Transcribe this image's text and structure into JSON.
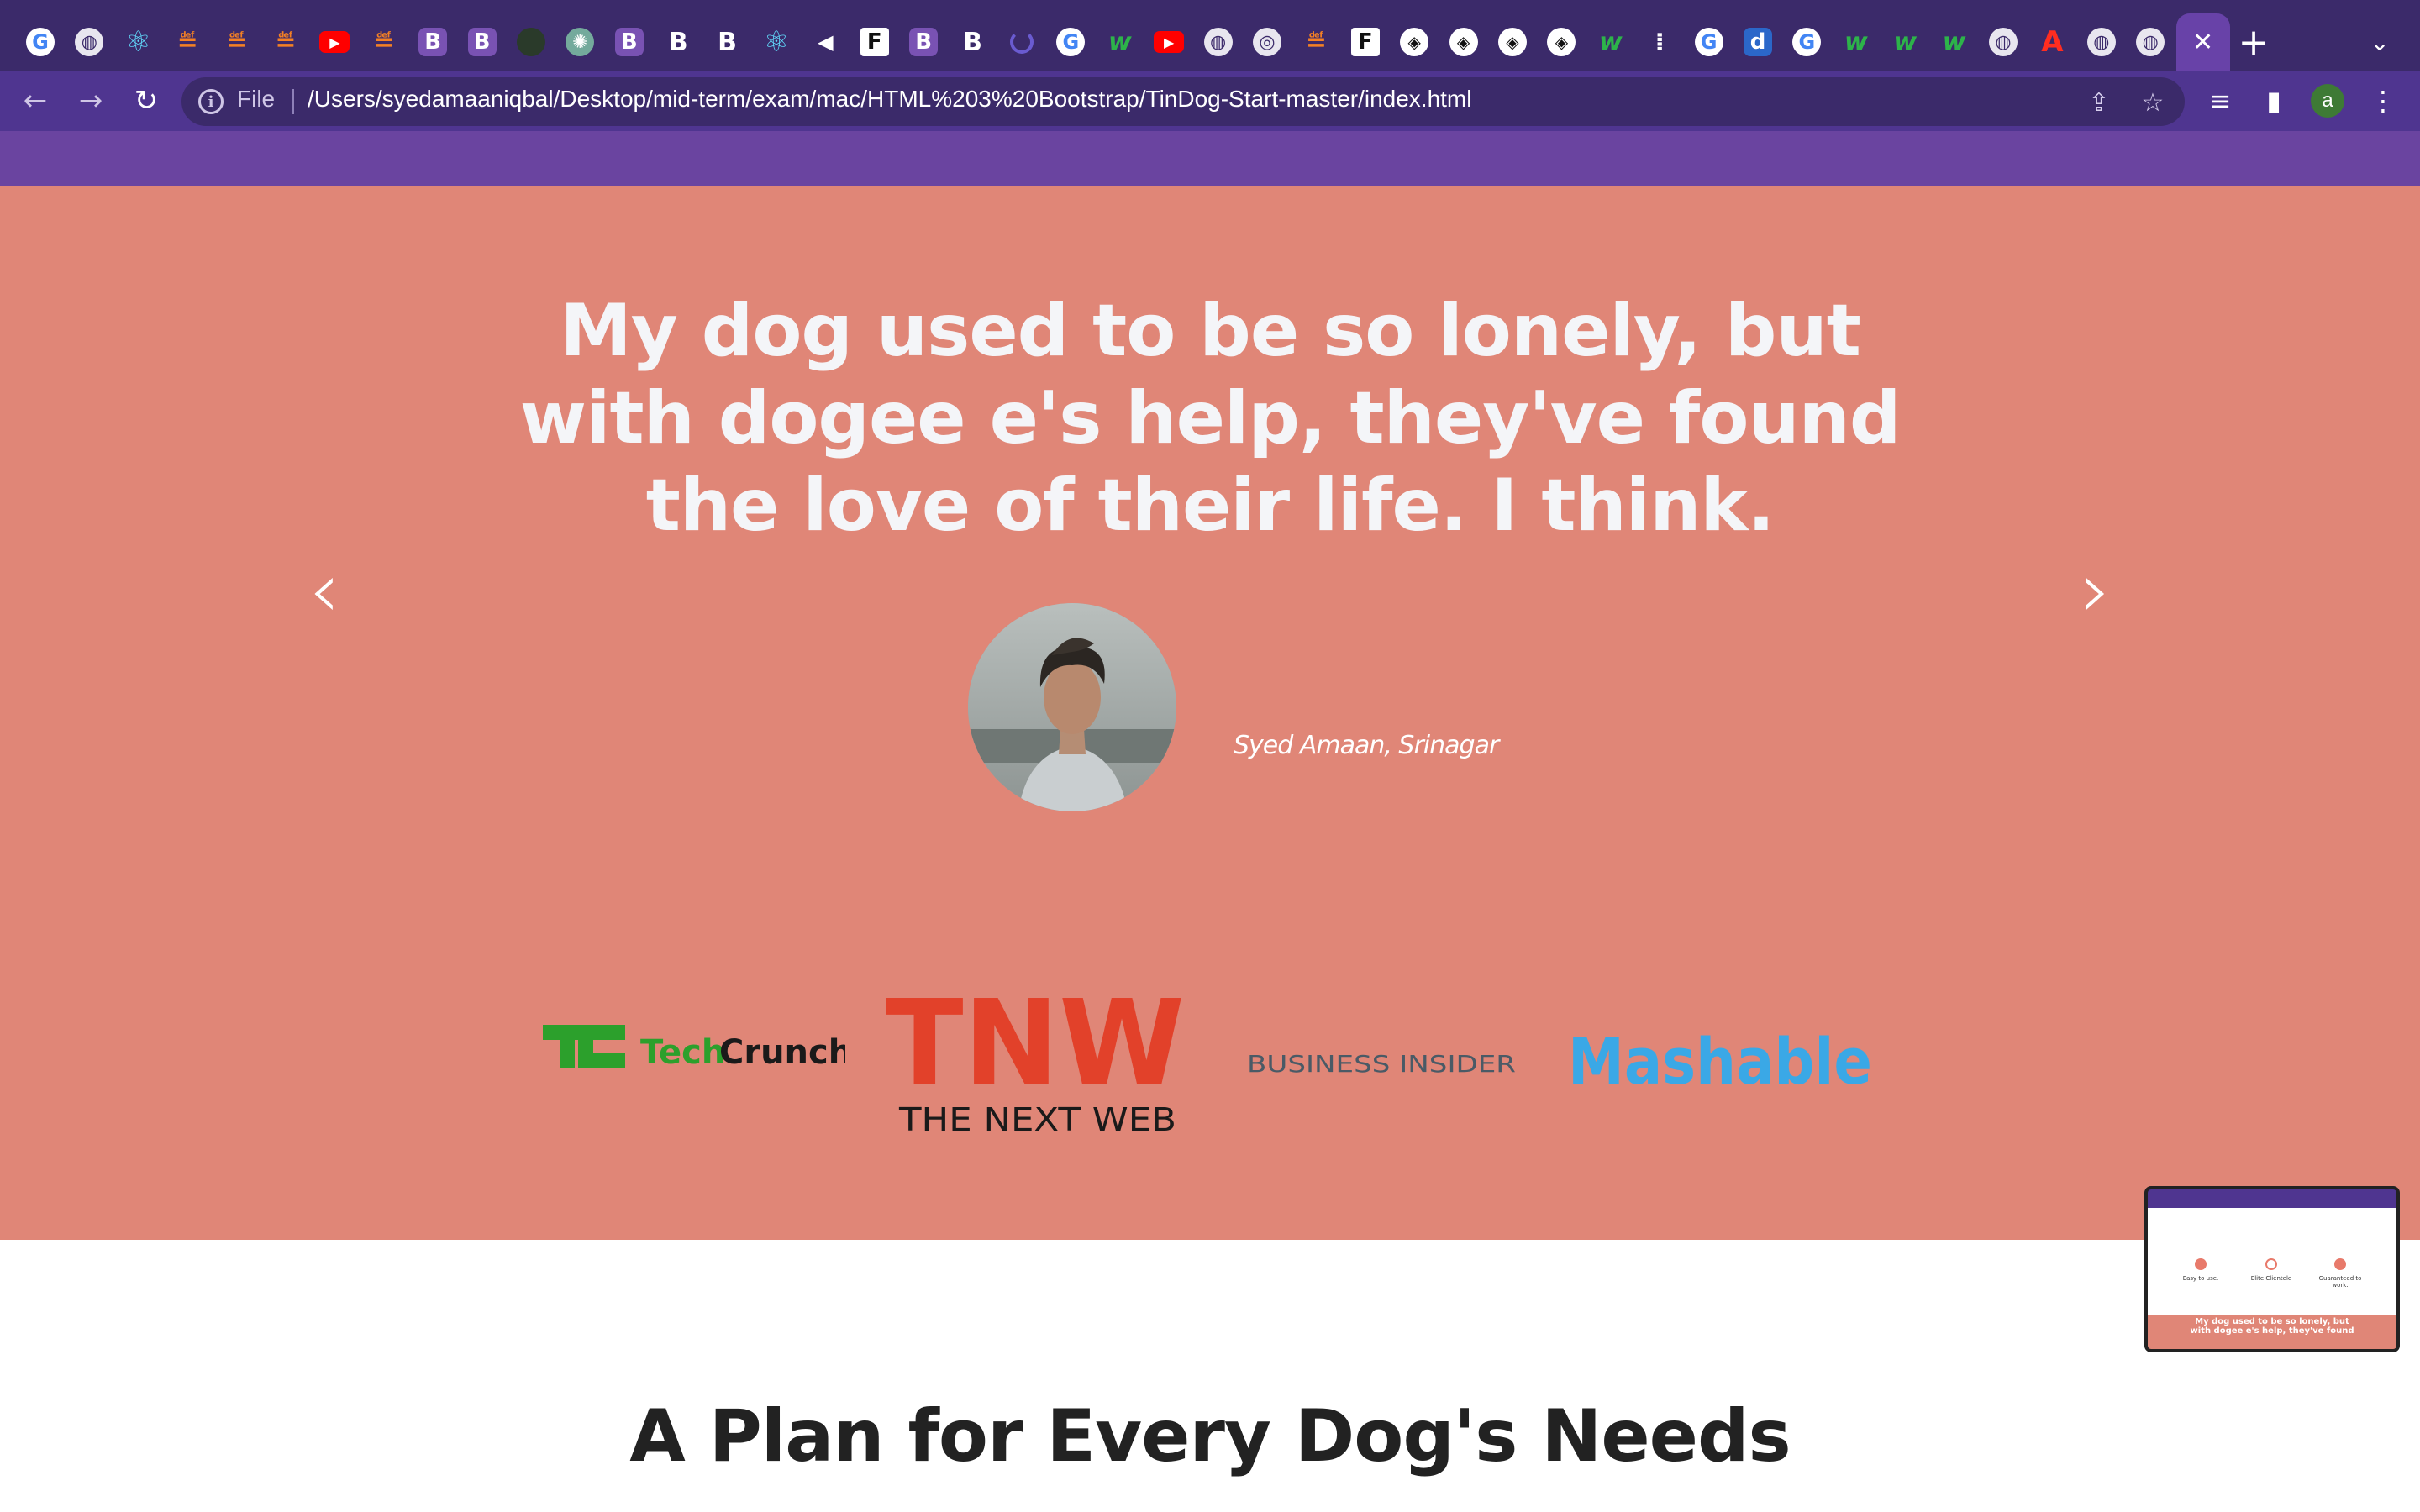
{
  "browser": {
    "tabs": [
      {
        "icon": "google-icon",
        "glyph": "G"
      },
      {
        "icon": "globe-icon",
        "glyph": "◍"
      },
      {
        "icon": "react-icon",
        "glyph": "⚛"
      },
      {
        "icon": "stackoverflow-icon",
        "glyph": "≝"
      },
      {
        "icon": "stackoverflow-icon",
        "glyph": "≝"
      },
      {
        "icon": "stackoverflow-icon",
        "glyph": "≝"
      },
      {
        "icon": "youtube-icon",
        "glyph": "▶"
      },
      {
        "icon": "stackoverflow-icon",
        "glyph": "≝"
      },
      {
        "icon": "gradient-b-icon",
        "glyph": "B"
      },
      {
        "icon": "gradient-b-icon",
        "glyph": "B"
      },
      {
        "icon": "dark-icon",
        "glyph": ""
      },
      {
        "icon": "chatgpt-icon",
        "glyph": "✺"
      },
      {
        "icon": "bootstrap-icon",
        "glyph": "B"
      },
      {
        "icon": "bold-b-icon",
        "glyph": "B"
      },
      {
        "icon": "bold-b-icon",
        "glyph": "B"
      },
      {
        "icon": "react-bootstrap-icon",
        "glyph": "⚛"
      },
      {
        "icon": "speaker-icon",
        "glyph": "◀"
      },
      {
        "icon": "f-icon",
        "glyph": "F"
      },
      {
        "icon": "bootstrap-icon",
        "glyph": "B"
      },
      {
        "icon": "bold-b-icon",
        "glyph": "B"
      },
      {
        "icon": "loading-icon",
        "glyph": ""
      },
      {
        "icon": "google-icon",
        "glyph": "G"
      },
      {
        "icon": "w3schools-icon",
        "glyph": "w"
      },
      {
        "icon": "youtube-icon",
        "glyph": "▶"
      },
      {
        "icon": "globe-icon",
        "glyph": "◍"
      },
      {
        "icon": "chrome-icon",
        "glyph": "◎"
      },
      {
        "icon": "stackoverflow-icon",
        "glyph": "≝"
      },
      {
        "icon": "f-icon",
        "glyph": "F"
      },
      {
        "icon": "codepen-icon",
        "glyph": "◈"
      },
      {
        "icon": "codepen-icon",
        "glyph": "◈"
      },
      {
        "icon": "codepen-icon",
        "glyph": "◈"
      },
      {
        "icon": "codepen-icon",
        "glyph": "◈"
      },
      {
        "icon": "w3schools-icon",
        "glyph": "w"
      },
      {
        "icon": "dots-icon",
        "glyph": "⁞"
      },
      {
        "icon": "google-icon",
        "glyph": "G"
      },
      {
        "icon": "d-icon",
        "glyph": "d"
      },
      {
        "icon": "google-icon",
        "glyph": "G"
      },
      {
        "icon": "w3schools-icon",
        "glyph": "w"
      },
      {
        "icon": "w3schools-icon",
        "glyph": "w"
      },
      {
        "icon": "w3schools-icon",
        "glyph": "w"
      },
      {
        "icon": "globe-icon",
        "glyph": "◍"
      },
      {
        "icon": "angular-icon",
        "glyph": "A"
      },
      {
        "icon": "globe-icon",
        "glyph": "◍"
      },
      {
        "icon": "globe-icon",
        "glyph": "◍"
      }
    ],
    "active_tab_close": "✕",
    "new_tab": "+",
    "tab_search": "⌄",
    "nav": {
      "back": "←",
      "forward": "→",
      "reload": "↻"
    },
    "omnibox": {
      "info": "i",
      "scheme_label": "File",
      "url": "/Users/syedamaaniqbal/Desktop/mid-term/exam/mac/HTML%203%20Bootstrap/TinDog-Start-master/index.html",
      "share": "⇪",
      "bookmark": "☆"
    },
    "toolbar": {
      "media": "≡",
      "side_panel": "▮",
      "profile_initial": "a",
      "menu": "⋮"
    }
  },
  "testimonial": {
    "quote": "My dog used to be so lonely, but with dogee e's help, they've found the love of their life. I think.",
    "author": "Syed Amaan, Srinagar",
    "prev": "‹",
    "next": "›"
  },
  "press": {
    "techcrunch": {
      "mark": "TC",
      "word_a": "Tech",
      "word_b": "Crunch"
    },
    "tnw": {
      "mark": "TNW",
      "tagline": "THE NEXT WEB"
    },
    "business_insider": "BUSINESS INSIDER",
    "mashable": "Mashable"
  },
  "pricing": {
    "title": "A Plan for Every Dog's Needs"
  },
  "pip_preview": {
    "caption_line1": "My dog used to be so lonely, but",
    "caption_line2": "with dogee e's help, they've found",
    "labels": [
      "Easy to use.",
      "Elite Clientele",
      "Guaranteed to work."
    ]
  },
  "colors": {
    "tabstrip": "#3b2a6a",
    "toolbar": "#4f3590",
    "navbar": "#6a44a0",
    "testimonial_bg": "#e08677",
    "quote_text": "#f4f5f8",
    "techcrunch_green": "#2ca02c",
    "tnw_red": "#e2412a",
    "mashable_blue": "#3aa8e6",
    "bi_gray": "#4a5a66"
  }
}
